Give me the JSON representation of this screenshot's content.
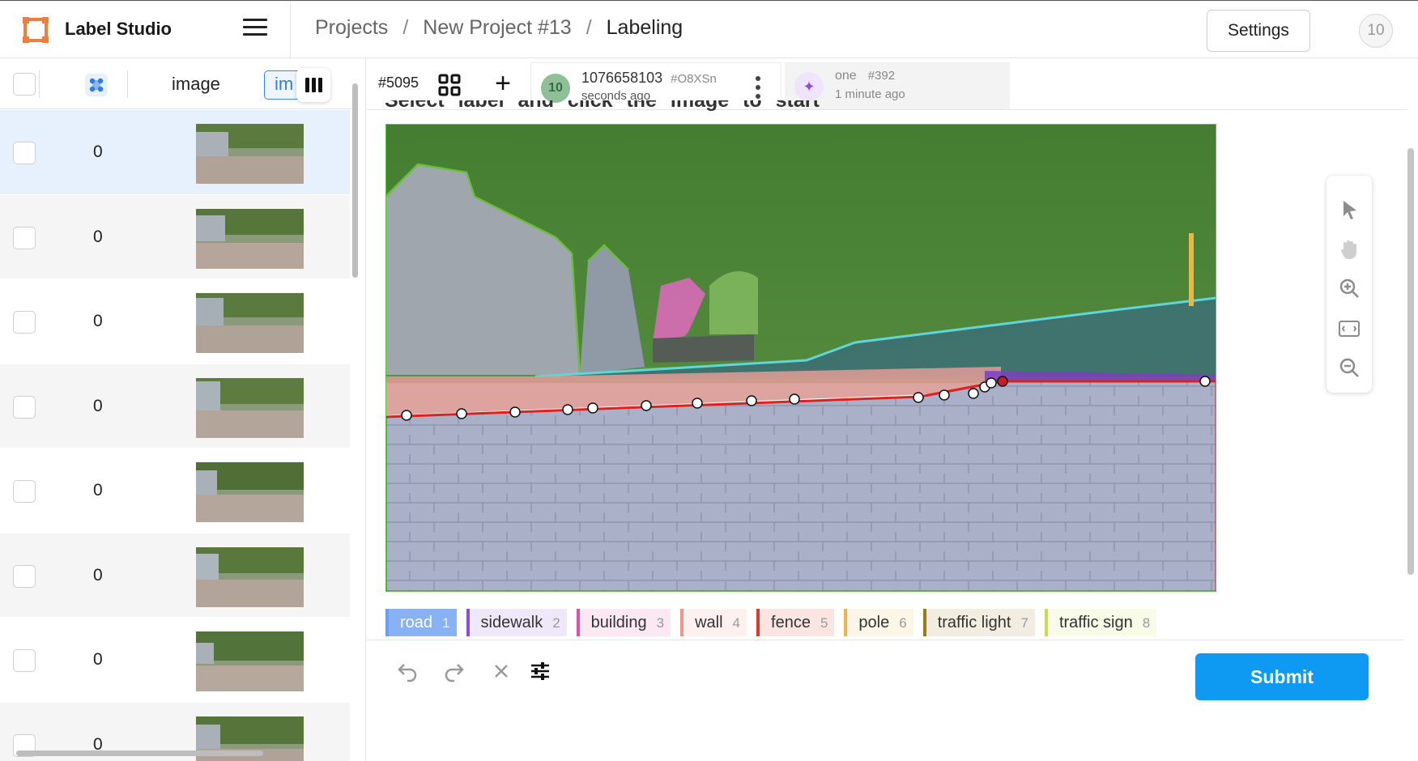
{
  "app": {
    "title": "Label Studio"
  },
  "breadcrumb": [
    "Projects",
    "New Project #13",
    "Labeling"
  ],
  "settings_label": "Settings",
  "user_avatar": "10",
  "list": {
    "header_image": "image",
    "header_im": "im",
    "rows": [
      {
        "count": "0"
      },
      {
        "count": "0"
      },
      {
        "count": "0"
      },
      {
        "count": "0"
      },
      {
        "count": "0"
      },
      {
        "count": "0"
      },
      {
        "count": "0"
      },
      {
        "count": "0"
      }
    ]
  },
  "task": {
    "id": "#5095"
  },
  "annotation": {
    "avatar": "10",
    "user": "1076658103",
    "hash": "#O8XSn",
    "time": "seconds ago"
  },
  "prediction": {
    "name": "one",
    "hash": "#392",
    "time": "1 minute ago"
  },
  "instruction": "Select label and click the image to start",
  "labels": [
    {
      "name": "road",
      "key": "1",
      "color": "#6a9ff0"
    },
    {
      "name": "sidewalk",
      "key": "2",
      "color": "#8a4fd8"
    },
    {
      "name": "building",
      "key": "3",
      "color": "#e04fa8"
    },
    {
      "name": "wall",
      "key": "4",
      "color": "#f0958d"
    },
    {
      "name": "fence",
      "key": "5",
      "color": "#e0392b"
    },
    {
      "name": "pole",
      "key": "6",
      "color": "#f2b34d"
    },
    {
      "name": "traffic light",
      "key": "7",
      "color": "#9c7a1a"
    },
    {
      "name": "traffic sign",
      "key": "8",
      "color": "#c7e04a"
    }
  ],
  "submit_label": "Submit",
  "colors": {
    "accent": "#0e9af2",
    "logo": "#f07d3c"
  }
}
